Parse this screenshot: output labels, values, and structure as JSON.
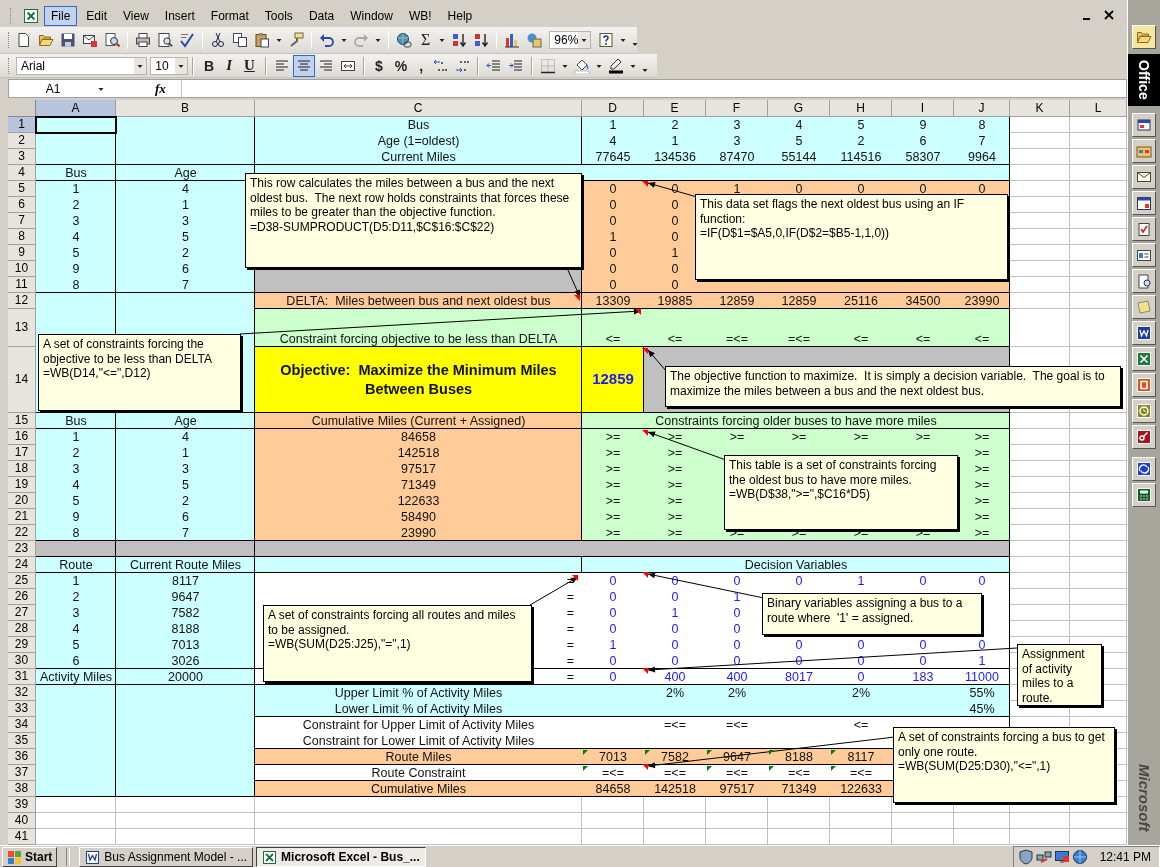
{
  "menu": {
    "items": [
      {
        "label": "File",
        "selected": true
      },
      {
        "label": "Edit",
        "selected": false
      },
      {
        "label": "View",
        "selected": false
      },
      {
        "label": "Insert",
        "selected": false
      },
      {
        "label": "Format",
        "selected": false
      },
      {
        "label": "Tools",
        "selected": false
      },
      {
        "label": "Data",
        "selected": false
      },
      {
        "label": "Window",
        "selected": false
      },
      {
        "label": "WB!",
        "selected": false
      },
      {
        "label": "Help",
        "selected": false
      }
    ]
  },
  "standard_toolbar": {
    "sum": "Σ",
    "zoom": "96%"
  },
  "formatting_toolbar": {
    "font": "Arial",
    "size": "10",
    "bold": "B",
    "italic": "I",
    "underline": "U",
    "currency": "$",
    "percent": "%",
    "comma": ",",
    "alignment": [
      {
        "selected": false
      },
      {
        "selected": true
      },
      {
        "selected": false
      }
    ]
  },
  "formula_bar": {
    "name_box": "A1",
    "function_label": "fx"
  },
  "sheet": {
    "columns": [
      {
        "label": "A",
        "selected": true
      },
      {
        "label": "B",
        "selected": false
      },
      {
        "label": "C",
        "selected": false
      },
      {
        "label": "D",
        "selected": false
      },
      {
        "label": "E",
        "selected": false
      },
      {
        "label": "F",
        "selected": false
      },
      {
        "label": "G",
        "selected": false
      },
      {
        "label": "H",
        "selected": false
      },
      {
        "label": "I",
        "selected": false
      },
      {
        "label": "J",
        "selected": false
      },
      {
        "label": "K",
        "selected": false
      },
      {
        "label": "L",
        "selected": false
      }
    ],
    "rows": [
      {
        "label": "1",
        "selected": true,
        "cells": {
          "C": "Bus",
          "D": "1",
          "E": "2",
          "F": "3",
          "G": "4",
          "H": "5",
          "I": "9",
          "J": "8"
        }
      },
      {
        "label": "2",
        "selected": false,
        "cells": {
          "C": "Age (1=oldest)",
          "D": "4",
          "E": "1",
          "F": "3",
          "G": "5",
          "H": "2",
          "I": "6",
          "J": "7"
        }
      },
      {
        "label": "3",
        "selected": false,
        "cells": {
          "C": "Current Miles",
          "D": "77645",
          "E": "134536",
          "F": "87470",
          "G": "55144",
          "H": "114516",
          "I": "58307",
          "J": "9964"
        }
      },
      {
        "label": "4",
        "selected": false,
        "cells": {
          "A": "Bus",
          "B": "Age"
        }
      },
      {
        "label": "5",
        "selected": false,
        "cells": {
          "A": "1",
          "B": "4",
          "D": "0",
          "E": "0",
          "F": "1",
          "G": "0",
          "H": "0",
          "I": "0",
          "J": "0"
        }
      },
      {
        "label": "6",
        "selected": false,
        "cells": {
          "A": "2",
          "B": "1",
          "D": "0",
          "E": "0"
        }
      },
      {
        "label": "7",
        "selected": false,
        "cells": {
          "A": "3",
          "B": "3",
          "D": "0",
          "E": "0"
        }
      },
      {
        "label": "8",
        "selected": false,
        "cells": {
          "A": "4",
          "B": "5",
          "D": "1",
          "E": "0"
        }
      },
      {
        "label": "9",
        "selected": false,
        "cells": {
          "A": "5",
          "B": "2",
          "D": "0",
          "E": "1"
        }
      },
      {
        "label": "10",
        "selected": false,
        "cells": {
          "A": "9",
          "B": "6",
          "D": "0",
          "E": "0"
        }
      },
      {
        "label": "11",
        "selected": false,
        "cells": {
          "A": "8",
          "B": "7",
          "D": "0",
          "E": "0"
        }
      },
      {
        "label": "12",
        "selected": false,
        "cells": {
          "C": "DELTA:  Miles between bus and next oldest bus",
          "D": "13309",
          "E": "19885",
          "F": "12859",
          "G": "12859",
          "H": "25116",
          "I": "34500",
          "J": "23990"
        }
      },
      {
        "label": "13",
        "selected": false,
        "cells": {
          "C": "Constraint forcing objective to be less than DELTA",
          "D": "<=",
          "E": "<=",
          "F": "=<=",
          "G": "=<=",
          "H": "<=",
          "I": "<=",
          "J": "<="
        }
      },
      {
        "label": "14",
        "selected": false,
        "cells": {
          "C": {
            "text": "Objective:  Maximize the Minimum Miles Between Buses",
            "kind": "title"
          },
          "D": {
            "text": "12859",
            "kind": "objective"
          }
        }
      },
      {
        "label": "15",
        "selected": false,
        "cells": {
          "A": "Bus",
          "B": "Age",
          "C": "Cumulative Miles (Current + Assigned)",
          "D:J": "Constraints forcing older buses to have more miles"
        }
      },
      {
        "label": "16",
        "selected": false,
        "cells": {
          "A": "1",
          "B": "4",
          "C": "84658",
          "D": ">=",
          "E": ">=",
          "F": ">=",
          "G": ">=",
          "H": ">=",
          "I": ">=",
          "J": ">="
        }
      },
      {
        "label": "17",
        "selected": false,
        "cells": {
          "A": "2",
          "B": "1",
          "C": "142518",
          "D": ">=",
          "E": ">=",
          "J": ">="
        }
      },
      {
        "label": "18",
        "selected": false,
        "cells": {
          "A": "3",
          "B": "3",
          "C": "97517",
          "D": ">=",
          "E": ">=",
          "J": ">="
        }
      },
      {
        "label": "19",
        "selected": false,
        "cells": {
          "A": "4",
          "B": "5",
          "C": "71349",
          "D": ">=",
          "E": ">=",
          "J": ">="
        }
      },
      {
        "label": "20",
        "selected": false,
        "cells": {
          "A": "5",
          "B": "2",
          "C": "122633",
          "D": ">=",
          "E": ">=",
          "J": ">="
        }
      },
      {
        "label": "21",
        "selected": false,
        "cells": {
          "A": "9",
          "B": "6",
          "C": "58490",
          "D": ">=",
          "E": ">=",
          "J": ">="
        }
      },
      {
        "label": "22",
        "selected": false,
        "cells": {
          "A": "8",
          "B": "7",
          "C": "23990",
          "D": ">=",
          "E": ">=",
          "F": ">=",
          "G": ">=",
          "H": ">=",
          "I": ">=",
          "J": ">="
        }
      },
      {
        "label": "23",
        "selected": false
      },
      {
        "label": "24",
        "selected": false,
        "cells": {
          "A": "Route",
          "B": "Current Route Miles",
          "D:J": "Decision Variables"
        }
      },
      {
        "label": "25",
        "selected": false,
        "cells": {
          "A": "1",
          "B": "8117",
          "C": {
            "text": "=",
            "kind": "relation"
          },
          "D": {
            "text": "0",
            "kind": "variable"
          },
          "E": {
            "text": "0",
            "kind": "variable"
          },
          "F": {
            "text": "0",
            "kind": "variable"
          },
          "G": {
            "text": "0",
            "kind": "variable"
          },
          "H": {
            "text": "1",
            "kind": "variable"
          },
          "I": {
            "text": "0",
            "kind": "variable"
          },
          "J": {
            "text": "0",
            "kind": "variable"
          }
        }
      },
      {
        "label": "26",
        "selected": false,
        "cells": {
          "A": "2",
          "B": "9647",
          "C": {
            "text": "=",
            "kind": "relation"
          },
          "D": {
            "text": "0",
            "kind": "variable"
          },
          "E": {
            "text": "0",
            "kind": "variable"
          },
          "F": {
            "text": "1",
            "kind": "variable"
          }
        }
      },
      {
        "label": "27",
        "selected": false,
        "cells": {
          "A": "3",
          "B": "7582",
          "C": {
            "text": "=",
            "kind": "relation"
          },
          "D": {
            "text": "0",
            "kind": "variable"
          },
          "E": {
            "text": "1",
            "kind": "variable"
          },
          "F": {
            "text": "0",
            "kind": "variable"
          }
        }
      },
      {
        "label": "28",
        "selected": false,
        "cells": {
          "A": "4",
          "B": "8188",
          "C": {
            "text": "=",
            "kind": "relation"
          },
          "D": {
            "text": "0",
            "kind": "variable"
          },
          "E": {
            "text": "0",
            "kind": "variable"
          },
          "F": {
            "text": "0",
            "kind": "variable"
          }
        }
      },
      {
        "label": "29",
        "selected": false,
        "cells": {
          "A": "5",
          "B": "7013",
          "C": {
            "text": "=",
            "kind": "relation"
          },
          "D": {
            "text": "1",
            "kind": "variable"
          },
          "E": {
            "text": "0",
            "kind": "variable"
          },
          "F": {
            "text": "0",
            "kind": "variable"
          },
          "G": {
            "text": "0",
            "kind": "variable"
          },
          "H": {
            "text": "0",
            "kind": "variable"
          },
          "I": {
            "text": "0",
            "kind": "variable"
          },
          "J": {
            "text": "0",
            "kind": "variable"
          }
        }
      },
      {
        "label": "30",
        "selected": false,
        "cells": {
          "A": "6",
          "B": "3026",
          "C": {
            "text": "=",
            "kind": "relation"
          },
          "D": {
            "text": "0",
            "kind": "variable"
          },
          "E": {
            "text": "0",
            "kind": "variable"
          },
          "F": {
            "text": "0",
            "kind": "variable"
          },
          "G": {
            "text": "0",
            "kind": "variable"
          },
          "H": {
            "text": "0",
            "kind": "variable"
          },
          "I": {
            "text": "0",
            "kind": "variable"
          },
          "J": {
            "text": "1",
            "kind": "variable"
          }
        }
      },
      {
        "label": "31",
        "selected": false,
        "cells": {
          "A": "Activity Miles",
          "B": "20000",
          "C": {
            "text": "=",
            "kind": "relation"
          },
          "D": {
            "text": "0",
            "kind": "variable"
          },
          "E": {
            "text": "400",
            "kind": "variable"
          },
          "F": {
            "text": "400",
            "kind": "variable"
          },
          "G": {
            "text": "8017",
            "kind": "variable"
          },
          "H": {
            "text": "0",
            "kind": "variable"
          },
          "I": {
            "text": "183",
            "kind": "variable"
          },
          "J": {
            "text": "11000",
            "kind": "variable"
          }
        }
      },
      {
        "label": "32",
        "selected": false,
        "cells": {
          "C": "Upper Limit % of Activity Miles",
          "E": "2%",
          "F": "2%",
          "H": "2%",
          "J": "55%"
        }
      },
      {
        "label": "33",
        "selected": false,
        "cells": {
          "C": "Lower Limit % of Activity Miles",
          "J": "45%"
        }
      },
      {
        "label": "34",
        "selected": false,
        "cells": {
          "C": "Constraint for Upper Limit of Activity Miles",
          "E": "=<=",
          "F": "=<=",
          "H": "<="
        }
      },
      {
        "label": "35",
        "selected": false,
        "cells": {
          "C": "Constraint for Lower Limit of Activity Miles"
        }
      },
      {
        "label": "36",
        "selected": false,
        "cells": {
          "C": "Route Miles",
          "D": "7013",
          "E": "7582",
          "F": "9647",
          "G": "8188",
          "H": "8117"
        }
      },
      {
        "label": "37",
        "selected": false,
        "cells": {
          "C": "Route Constraint",
          "D": "=<=",
          "E": "=<=",
          "F": "=<=",
          "G": "=<=",
          "H": "=<="
        }
      },
      {
        "label": "38",
        "selected": false,
        "cells": {
          "C": "Cumulative Miles",
          "D": "84658",
          "E": "142518",
          "F": "97517",
          "G": "71349",
          "H": "122633"
        }
      },
      {
        "label": "39",
        "selected": false
      },
      {
        "label": "40",
        "selected": false
      },
      {
        "label": "41",
        "selected": false
      }
    ],
    "comments": [
      {
        "paragraphs": [
          "This row calculates the miles between a bus and the next oldest bus.  The next row holds constraints that forces these miles to be greater than the objective function.",
          "=D38-SUMPRODUCT(D5:D11,$C$16:$C$22)"
        ]
      },
      {
        "paragraphs": [
          "This data set flags the next oldest bus using an IF function:",
          "=IF(D$1=$A5,0,IF(D$2=$B5-1,1,0))"
        ]
      },
      {
        "paragraphs": [
          "A set of constraints forcing the objective to be less than DELTA",
          "=WB(D14,\"<=\",D12)"
        ]
      },
      {
        "paragraphs": [
          "The objective function to maximize.  It is simply a decision variable.  The goal is to maximize the miles between a bus and the next oldest bus."
        ]
      },
      {
        "paragraphs": [
          "This table is a set of constraints forcing the oldest bus to have more miles.",
          "=WB(D$38,\">=\",$C16*D5)"
        ]
      },
      {
        "paragraphs": [
          "Binary variables assigning a bus to a route where  '1' = assigned."
        ]
      },
      {
        "paragraphs": [
          "A set of constraints forcing all routes and miles to be assigned.",
          "=WB(SUM(D25:J25),\"=\",1)"
        ]
      },
      {
        "paragraphs": [
          "Assignment of activity miles to a route."
        ]
      },
      {
        "paragraphs": [
          "A set of constraints forcing a bus to get only one route.",
          "=WB(SUM(D25:D30),\"<=\",1)"
        ]
      }
    ]
  },
  "office_bar": {
    "title": "Office",
    "brand": "Microsoft"
  },
  "taskbar": {
    "start": "Start",
    "tasks": [
      {
        "label": "Bus Assignment Model - ...",
        "kind": "document",
        "selected": false
      },
      {
        "label": "Microsoft Excel - Bus_...",
        "kind": "spreadsheet",
        "selected": true
      }
    ],
    "clock": "12:41 PM"
  }
}
